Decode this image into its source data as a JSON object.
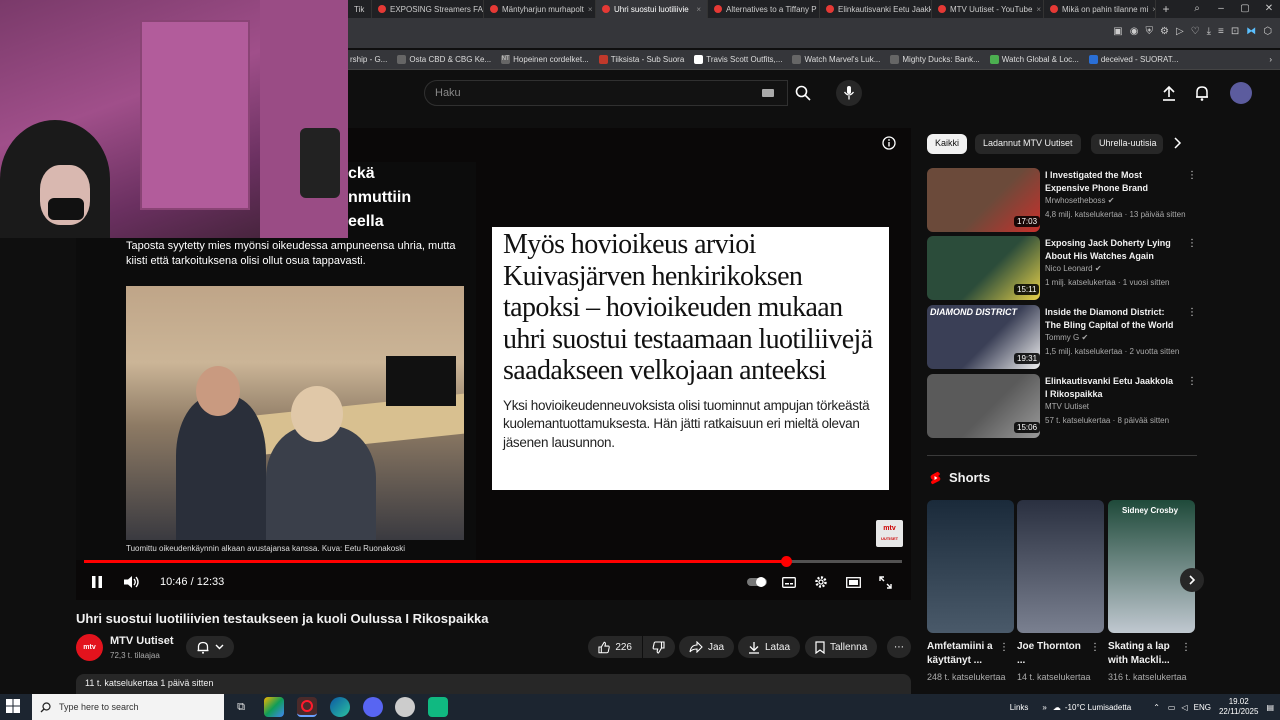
{
  "browser": {
    "tabs": [
      {
        "label": "EXPOSING Streamers FAKE"
      },
      {
        "label": "Mäntyharjun murhapolt"
      },
      {
        "label": "Uhri suostui luotiliivie",
        "active": true
      },
      {
        "label": "Alternatives to a Tiffany P"
      },
      {
        "label": "Elinkautisvanki Eetu Jaakk"
      },
      {
        "label": "MTV Uutiset - YouTube"
      },
      {
        "label": "Mikä on pahin tilanne mi"
      }
    ],
    "tab_close": "×",
    "new_tab": "+",
    "tiktok_fragment": "Tik",
    "bookmarks": [
      "rship - G...",
      "Osta CBD & CBG Ke...",
      "Hopeinen cordelket...",
      "Tiiksista - Sub Suora",
      "Travis Scott Outfits,...",
      "Watch Marvel's Luk...",
      "Mighty Ducks: Bank...",
      "Watch Global & Loc...",
      "deceived - SUORAT..."
    ],
    "bookmark_short": {
      "nt": "NT"
    }
  },
  "youtube": {
    "search_placeholder": "Haku"
  },
  "video": {
    "left_heading_lines": [
      "ckä",
      "nmuttiin",
      "eella"
    ],
    "left_caption": "Taposta syytetty mies myönsi oikeudessa ampuneensa uhria, mutta kiisti että tarkoituksena olisi ollut osua tappavasti.",
    "photo_credit": "Tuomittu oikeudenkäynnin alkaan avustajansa kanssa. Kuva: Eetu Ruonakoski",
    "article_headline": "Myös hovioikeus arvioi Kuivasjärven henkirikoksen tapoksi – hovioikeuden mukaan uhri suostui testaamaan luotiliivejä saadakseen velkojaan anteeksi",
    "article_lead": "Yksi hovioikeudenneuvoksista olisi tuominnut ampujan törkeästä kuolemantuottamuksesta. Hän jätti ratkaisuun eri mieltä olevan jäsenen lausunnon.",
    "logo_text": "mtv",
    "logo_sub": "UUTISET",
    "time_current": "10:46",
    "time_sep": " / ",
    "time_total": "12:33",
    "progress_fraction": 0.858,
    "title": "Uhri suostui luotiliivien testaukseen ja kuoli Oulussa I Rikospaikka"
  },
  "channel": {
    "avatar_text": "mtv",
    "name": "MTV Uutiset",
    "subscribers": "72,3 t. tilaajaa"
  },
  "actions": {
    "likes": "226",
    "share": "Jaa",
    "download": "Lataa",
    "save": "Tallenna",
    "more": "⋯"
  },
  "description": {
    "meta": "11 t. katselukertaa  1 päivä sitten"
  },
  "chips": [
    {
      "label": "Kaikki",
      "active": true
    },
    {
      "label": "Ladannut MTV Uutiset"
    },
    {
      "label": "Uhrella-uutisia"
    }
  ],
  "recommendations": [
    {
      "title": "I Investigated the Most Expensive Phone Brand",
      "channel": "Mrwhosetheboss",
      "views": "4,8 milj. katselukertaa · 13 päivää sitten",
      "duration": "17:03",
      "thumb_color": "#6b4a3a",
      "thumb_accent": "#c9302c",
      "verified": true
    },
    {
      "title": "Exposing Jack Doherty Lying About His Watches Again",
      "channel": "Nico Leonard",
      "views": "1 milj. katselukertaa · 1 vuosi sitten",
      "duration": "15:11",
      "thumb_color": "#2b4c3a",
      "thumb_accent": "#e8d24a",
      "verified": true
    },
    {
      "title": "Inside the Diamond District: The Bling Capital of the World",
      "channel": "Tommy G",
      "views": "1,5 milj. katselukertaa · 2 vuotta sitten",
      "duration": "19:31",
      "thumb_color": "#3a3f56",
      "thumb_accent": "#f0f0f0",
      "verified": true,
      "thumb_text": "DIAMOND DISTRICT"
    },
    {
      "title": "Elinkautisvanki Eetu Jaakkola I Rikospaikka",
      "channel": "MTV Uutiset",
      "views": "57 t. katselukertaa · 8 päivää sitten",
      "duration": "15:06",
      "thumb_color": "#5a5a5a",
      "thumb_accent": "#9a9a9a",
      "verified": false
    }
  ],
  "shorts": {
    "header": "Shorts",
    "items": [
      {
        "title": "Amfetamiini a käyttänyt ...",
        "views": "248 t. katselukertaa",
        "color_top": "#1a2a3a",
        "color_bottom": "#4a5a6a"
      },
      {
        "title": "Joe Thornton ...",
        "views": "14 t. katselukertaa",
        "color_top": "#2a3040",
        "color_bottom": "#7a8090"
      },
      {
        "title": "Skating a lap with Mackli...",
        "views": "316 t. katselukertaa",
        "color_top": "#1f4a3a",
        "color_bottom": "#c0c8d0",
        "thumb_text": "Sidney Crosby"
      }
    ]
  },
  "taskbar": {
    "search_placeholder": "Type here to search",
    "links": "Links",
    "weather": "-10°C Lumisadetta",
    "lang": "ENG",
    "time": "19.02",
    "date": "22/11/2025"
  }
}
